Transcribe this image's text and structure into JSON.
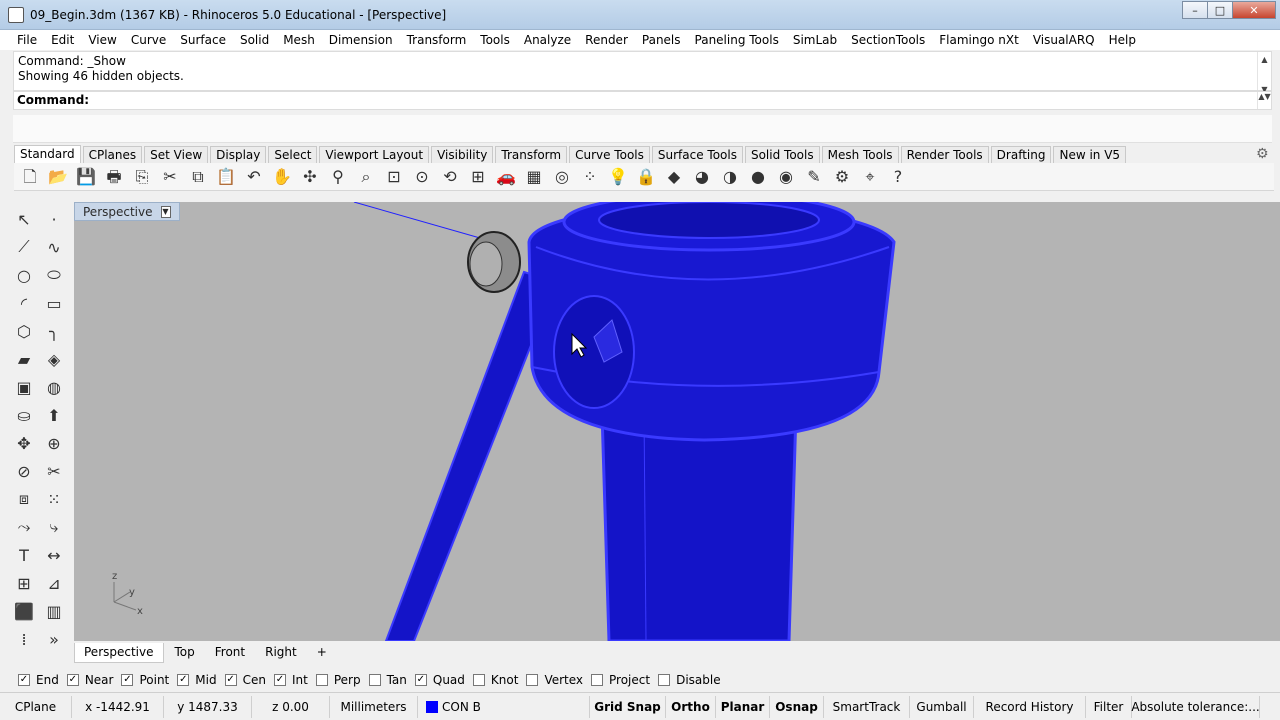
{
  "window": {
    "title": "09_Begin.3dm (1367 KB) - Rhinoceros 5.0 Educational - [Perspective]",
    "btn_min": "–",
    "btn_max": "□",
    "btn_close": "✕"
  },
  "menu": [
    "File",
    "Edit",
    "View",
    "Curve",
    "Surface",
    "Solid",
    "Mesh",
    "Dimension",
    "Transform",
    "Tools",
    "Analyze",
    "Render",
    "Panels",
    "Paneling Tools",
    "SimLab",
    "SectionTools",
    "Flamingo nXt",
    "VisualARQ",
    "Help"
  ],
  "history": {
    "line1": "Command: _Show",
    "line2": "Showing 46 hidden objects."
  },
  "command": {
    "label": "Command:"
  },
  "toolbar_tabs": [
    "Standard",
    "CPlanes",
    "Set View",
    "Display",
    "Select",
    "Viewport Layout",
    "Visibility",
    "Transform",
    "Curve Tools",
    "Surface Tools",
    "Solid Tools",
    "Mesh Tools",
    "Render Tools",
    "Drafting",
    "New in V5"
  ],
  "toolbar_icons": [
    "new-icon",
    "open-icon",
    "save-icon",
    "print-icon",
    "import-icon",
    "cut-icon",
    "copy-icon",
    "paste-icon",
    "undo-icon",
    "pan-icon",
    "rotate-view-icon",
    "zoom-icon",
    "zoom-window-icon",
    "zoom-extents-icon",
    "zoom-selected-icon",
    "undo-view-icon",
    "four-viewports-icon",
    "car-render-icon",
    "grid-icon",
    "circle-snap-icon",
    "points-icon",
    "light-bulb-icon",
    "lock-icon",
    "layers-icon",
    "color-wheel-icon",
    "shade-icon",
    "render-sphere-icon",
    "material-icon",
    "analysis-icon",
    "options-icon",
    "select-filter-icon",
    "help-icon"
  ],
  "left_tools": [
    "select-arrow-icon",
    "point-icon",
    "polyline-icon",
    "curve-icon",
    "circle-icon",
    "ellipse-icon",
    "arc-icon",
    "rectangle-icon",
    "polygon-icon",
    "fillet-icon",
    "surface-icon",
    "loft-icon",
    "box-icon",
    "sphere-icon",
    "cylinder-icon",
    "extrude-icon",
    "transform-icon",
    "boolean-icon",
    "split-icon",
    "trim-icon",
    "group-icon",
    "array-icon",
    "curve-edit-icon",
    "blend-icon",
    "text-icon",
    "dimension-icon",
    "grid-snap-icon",
    "analyze-icon",
    "render-box-icon",
    "hatch-icon",
    "more-tools-icon",
    "expand-icon"
  ],
  "viewport": {
    "label": "Perspective",
    "axis_z": "z",
    "axis_y": "y",
    "axis_x": "x"
  },
  "viewport_tabs": [
    "Perspective",
    "Top",
    "Front",
    "Right",
    "+"
  ],
  "osnaps": [
    {
      "label": "End",
      "checked": true
    },
    {
      "label": "Near",
      "checked": true
    },
    {
      "label": "Point",
      "checked": true
    },
    {
      "label": "Mid",
      "checked": true
    },
    {
      "label": "Cen",
      "checked": true
    },
    {
      "label": "Int",
      "checked": true
    },
    {
      "label": "Perp",
      "checked": false
    },
    {
      "label": "Tan",
      "checked": false
    },
    {
      "label": "Quad",
      "checked": true
    },
    {
      "label": "Knot",
      "checked": false
    },
    {
      "label": "Vertex",
      "checked": false
    },
    {
      "label": "Project",
      "checked": false
    },
    {
      "label": "Disable",
      "checked": false
    }
  ],
  "status": {
    "cplane": "CPlane",
    "x": "x -1442.91",
    "y": "y 1487.33",
    "z": "z 0.00",
    "units": "Millimeters",
    "layer": "CON B",
    "layer_color": "#0000ff",
    "grid_snap": "Grid Snap",
    "ortho": "Ortho",
    "planar": "Planar",
    "osnap": "Osnap",
    "smarttrack": "SmartTrack",
    "gumball": "Gumball",
    "record_history": "Record History",
    "filter": "Filter",
    "tolerance": "Absolute tolerance:..."
  },
  "colors": {
    "model_blue": "#1414c8",
    "model_edge": "#3a3aff",
    "viewport_bg": "#b4b4b4"
  }
}
